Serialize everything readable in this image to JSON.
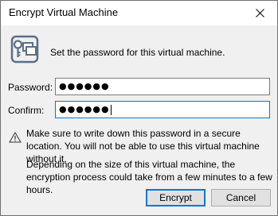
{
  "window": {
    "title": "Encrypt Virtual Machine",
    "close_icon": "close-icon"
  },
  "intro": {
    "icon": "key-icon",
    "text": "Set the password for this virtual machine."
  },
  "form": {
    "password_label": "Password:",
    "password_value": "●●●●●●",
    "confirm_label": "Confirm:",
    "confirm_value": "●●●●●●"
  },
  "notice": {
    "icon": "warning-icon",
    "warning_text": "Make sure to write down this password in a secure location. You will not be able to use this virtual machine without it.",
    "info_text": "Depending on the size of this virtual machine, the encryption process could take from a few minutes to a few hours."
  },
  "buttons": {
    "encrypt_label": "Encrypt",
    "cancel_label": "Cancel"
  },
  "colors": {
    "focus_border": "#0078d7",
    "dialog_bg": "#f0f0f0"
  }
}
